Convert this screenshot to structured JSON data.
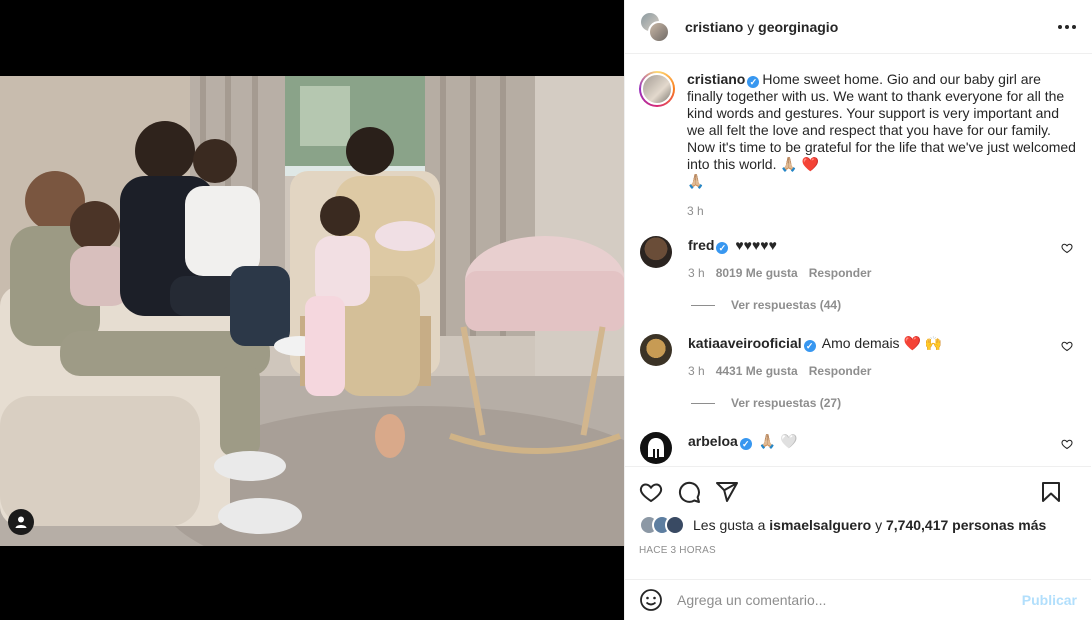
{
  "header": {
    "user1": "cristiano",
    "separator": "y",
    "user2": "georginagio"
  },
  "caption": {
    "username": "cristiano",
    "text": "Home sweet home. Gio and our baby girl are finally together with us. We want to thank everyone for all the kind words and gestures. Your support is very important and we all felt the love and respect that you have for our family. Now it's time to be grateful for the life that we've just welcomed into this world. 🙏🏼 ",
    "heart": "❤️",
    "trailing": " 🙏🏼",
    "time": "3 h"
  },
  "comments": [
    {
      "username": "fred",
      "verified": true,
      "text": "♥♥♥♥♥",
      "time": "3 h",
      "likes": "8019 Me gusta",
      "reply_label": "Responder",
      "view_replies": "Ver respuestas (44)"
    },
    {
      "username": "katiaaveirooficial",
      "verified": true,
      "text": "Amo demais ❤️ 🙌",
      "time": "3 h",
      "likes": "4431 Me gusta",
      "reply_label": "Responder",
      "view_replies": "Ver respuestas (27)"
    },
    {
      "username": "arbeloa",
      "verified": true,
      "text": "🙏🏼 🤍"
    }
  ],
  "likes": {
    "prefix": "Les gusta a",
    "user": "ismaelsalguero",
    "connector": "y",
    "count": "7,740,417 personas más"
  },
  "timestamp": "HACE 3 HORAS",
  "add_comment": {
    "placeholder": "Agrega un comentario...",
    "publish": "Publicar"
  },
  "icons": {
    "more": "more-options-icon",
    "like": "heart-outline-icon",
    "comment": "comment-bubble-icon",
    "share": "paper-plane-icon",
    "save": "bookmark-icon",
    "emoji": "smiley-icon",
    "user_tag": "user-silhouette-icon"
  },
  "colors": {
    "verified": "#3897f0",
    "publish_disabled": "#b2dffc",
    "meta_gray": "#8e8e8e",
    "text": "#262626"
  }
}
